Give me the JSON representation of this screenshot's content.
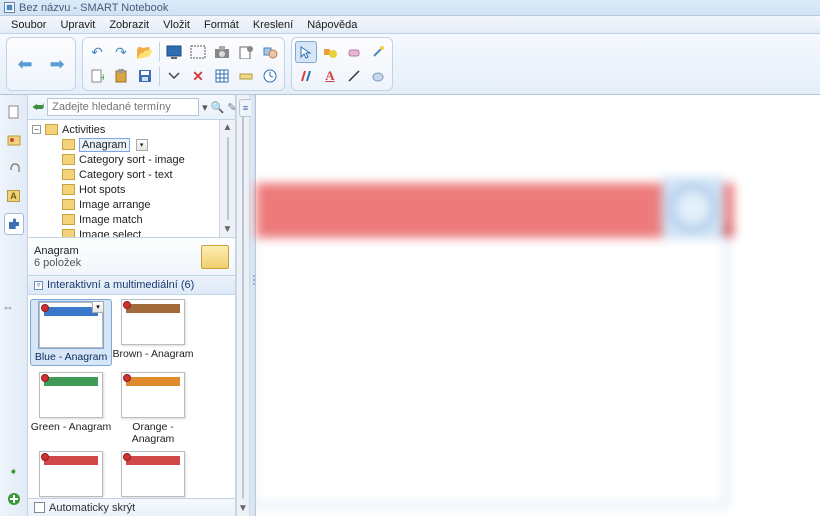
{
  "window": {
    "title": "Bez názvu - SMART Notebook"
  },
  "menu": {
    "items": [
      "Soubor",
      "Upravit",
      "Zobrazit",
      "Vložit",
      "Formát",
      "Kreslení",
      "Nápověda"
    ]
  },
  "search": {
    "placeholder": "Zadejte hledané termíny"
  },
  "tree": {
    "root": "Activities",
    "items": [
      "Anagram",
      "Category sort - image",
      "Category sort - text",
      "Hot spots",
      "Image arrange",
      "Image match",
      "Image select"
    ],
    "selected_index": 0
  },
  "panel": {
    "title": "Anagram",
    "subtitle": "6 položek"
  },
  "section": {
    "title": "Interaktivní a multimediální (6)"
  },
  "thumbnails": [
    {
      "label": "Blue - Anagram",
      "stripe": "#3a78c9",
      "selected": true
    },
    {
      "label": "Brown - Anagram",
      "stripe": "#a06a3a",
      "selected": false
    },
    {
      "label": "Green - Anagram",
      "stripe": "#3f9a55",
      "selected": false
    },
    {
      "label": "Orange - Anagram",
      "stripe": "#e08a2e",
      "selected": false
    },
    {
      "label": "",
      "stripe": "#d04848",
      "selected": false
    },
    {
      "label": "",
      "stripe": "#d04848",
      "selected": false
    }
  ],
  "autohide": {
    "label": "Automaticky skrýt",
    "checked": false
  },
  "toolbar_icons": {
    "nav_back": "back-arrow-icon",
    "nav_fwd": "forward-arrow-icon",
    "undo": "undo-icon",
    "redo": "redo-icon",
    "open": "folder-open-icon",
    "new_page": "new-page-icon",
    "paste": "paste-icon",
    "save": "save-icon",
    "screen": "screen-icon",
    "camera": "camera-icon",
    "capture": "capture-region-icon",
    "doc_cam": "document-camera-icon",
    "table": "table-icon",
    "ruler": "ruler-icon",
    "delete": "delete-x-icon",
    "grid": "grid-icon",
    "clock": "clock-icon",
    "cursor": "cursor-select-icon",
    "shapes": "shapes-icon",
    "eraser": "eraser-icon",
    "magic": "magic-pen-icon",
    "pens": "pens-icon",
    "text": "text-a-icon",
    "line": "line-icon",
    "fill": "fill-icon",
    "color": "color-icon"
  },
  "side_tabs": {
    "page_sorter": "page-sorter-icon",
    "gallery": "gallery-icon",
    "attachments": "attachment-icon",
    "properties": "properties-icon",
    "addons": "addons-puzzle-icon"
  }
}
